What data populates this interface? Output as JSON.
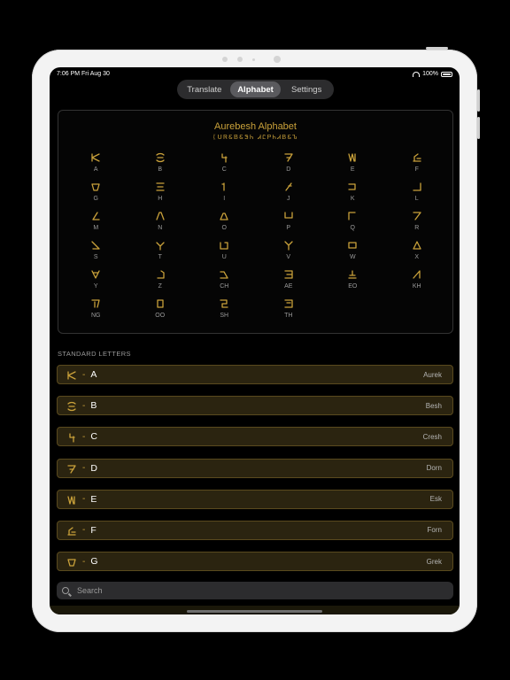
{
  "status_bar": {
    "time_date": "7:06 PM   Fri Aug 30",
    "battery": "100%"
  },
  "tabs": [
    {
      "label": "Translate",
      "active": false
    },
    {
      "label": "Alphabet",
      "active": true
    },
    {
      "label": "Settings",
      "active": false
    }
  ],
  "alphabet_card": {
    "title": "Aurebesh Alphabet",
    "subtitle_glyph_text": "ᛕᑌᏒᏋᏴᏋᏕᏂ ᏗᏝᏢᏂᏗᏴᏋᏖ",
    "letters": [
      "A",
      "B",
      "C",
      "D",
      "E",
      "F",
      "G",
      "H",
      "I",
      "J",
      "K",
      "L",
      "M",
      "N",
      "O",
      "P",
      "Q",
      "R",
      "S",
      "T",
      "U",
      "V",
      "W",
      "X",
      "Y",
      "Z",
      "CH",
      "AE",
      "EO",
      "KH",
      "NG",
      "OO",
      "SH",
      "TH"
    ]
  },
  "section_header": "STANDARD LETTERS",
  "letter_rows": [
    {
      "letter": "A",
      "name": "Aurek"
    },
    {
      "letter": "B",
      "name": "Besh"
    },
    {
      "letter": "C",
      "name": "Cresh"
    },
    {
      "letter": "D",
      "name": "Dorn"
    },
    {
      "letter": "E",
      "name": "Esk"
    },
    {
      "letter": "F",
      "name": "Forn"
    },
    {
      "letter": "G",
      "name": "Grek"
    }
  ],
  "row_separator": "-",
  "search": {
    "placeholder": "Search"
  },
  "colors": {
    "accent_gold": "#c9a13a",
    "row_bg": "#2b2410",
    "row_border": "#5a4a1e"
  }
}
